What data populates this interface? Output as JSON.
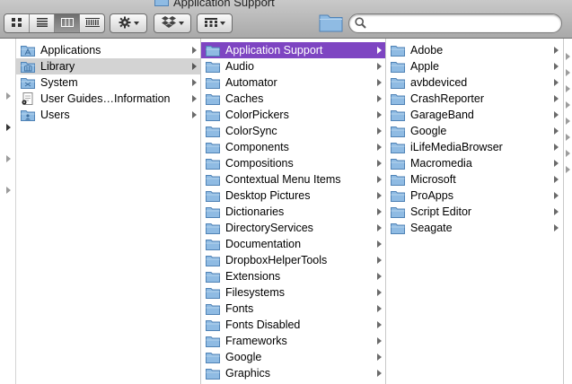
{
  "window": {
    "title": "Application Support"
  },
  "toolbar": {
    "views": [
      {
        "name": "icon-view",
        "active": false
      },
      {
        "name": "list-view",
        "active": false
      },
      {
        "name": "column-view",
        "active": true
      },
      {
        "name": "coverflow-view",
        "active": false
      }
    ],
    "search": {
      "value": "",
      "placeholder": ""
    }
  },
  "columns": [
    {
      "items": [
        {
          "label": "Applications",
          "icon": "applications-folder-icon",
          "arrow": true,
          "state": ""
        },
        {
          "label": "Library",
          "icon": "library-folder-icon",
          "arrow": true,
          "state": "path"
        },
        {
          "label": "System",
          "icon": "system-folder-icon",
          "arrow": true,
          "state": ""
        },
        {
          "label": "User Guides…Information",
          "icon": "document-folder-icon",
          "arrow": true,
          "state": ""
        },
        {
          "label": "Users",
          "icon": "users-folder-icon",
          "arrow": true,
          "state": ""
        }
      ]
    },
    {
      "items": [
        {
          "label": "Application Support",
          "icon": "folder-icon",
          "arrow": true,
          "state": "selected"
        },
        {
          "label": "Audio",
          "icon": "folder-icon",
          "arrow": true,
          "state": ""
        },
        {
          "label": "Automator",
          "icon": "folder-icon",
          "arrow": true,
          "state": ""
        },
        {
          "label": "Caches",
          "icon": "folder-icon",
          "arrow": true,
          "state": ""
        },
        {
          "label": "ColorPickers",
          "icon": "folder-icon",
          "arrow": true,
          "state": ""
        },
        {
          "label": "ColorSync",
          "icon": "folder-icon",
          "arrow": true,
          "state": ""
        },
        {
          "label": "Components",
          "icon": "folder-icon",
          "arrow": true,
          "state": ""
        },
        {
          "label": "Compositions",
          "icon": "folder-icon",
          "arrow": true,
          "state": ""
        },
        {
          "label": "Contextual Menu Items",
          "icon": "folder-icon",
          "arrow": true,
          "state": ""
        },
        {
          "label": "Desktop Pictures",
          "icon": "folder-icon",
          "arrow": true,
          "state": ""
        },
        {
          "label": "Dictionaries",
          "icon": "folder-icon",
          "arrow": true,
          "state": ""
        },
        {
          "label": "DirectoryServices",
          "icon": "folder-icon",
          "arrow": true,
          "state": ""
        },
        {
          "label": "Documentation",
          "icon": "folder-icon",
          "arrow": true,
          "state": ""
        },
        {
          "label": "DropboxHelperTools",
          "icon": "folder-icon",
          "arrow": true,
          "state": ""
        },
        {
          "label": "Extensions",
          "icon": "folder-icon",
          "arrow": true,
          "state": ""
        },
        {
          "label": "Filesystems",
          "icon": "folder-icon",
          "arrow": true,
          "state": ""
        },
        {
          "label": "Fonts",
          "icon": "folder-icon",
          "arrow": true,
          "state": ""
        },
        {
          "label": "Fonts Disabled",
          "icon": "folder-icon",
          "arrow": true,
          "state": ""
        },
        {
          "label": "Frameworks",
          "icon": "folder-icon",
          "arrow": true,
          "state": ""
        },
        {
          "label": "Google",
          "icon": "folder-icon",
          "arrow": true,
          "state": ""
        },
        {
          "label": "Graphics",
          "icon": "folder-icon",
          "arrow": true,
          "state": ""
        }
      ]
    },
    {
      "items": [
        {
          "label": "Adobe",
          "icon": "folder-icon",
          "arrow": true,
          "state": ""
        },
        {
          "label": "Apple",
          "icon": "folder-icon",
          "arrow": true,
          "state": ""
        },
        {
          "label": "avbdeviced",
          "icon": "folder-icon",
          "arrow": true,
          "state": ""
        },
        {
          "label": "CrashReporter",
          "icon": "folder-icon",
          "arrow": true,
          "state": ""
        },
        {
          "label": "GarageBand",
          "icon": "folder-icon",
          "arrow": true,
          "state": ""
        },
        {
          "label": "Google",
          "icon": "folder-icon",
          "arrow": true,
          "state": ""
        },
        {
          "label": "iLifeMediaBrowser",
          "icon": "folder-icon",
          "arrow": true,
          "state": ""
        },
        {
          "label": "Macromedia",
          "icon": "folder-icon",
          "arrow": true,
          "state": ""
        },
        {
          "label": "Microsoft",
          "icon": "folder-icon",
          "arrow": true,
          "state": ""
        },
        {
          "label": "ProApps",
          "icon": "folder-icon",
          "arrow": true,
          "state": ""
        },
        {
          "label": "Script Editor",
          "icon": "folder-icon",
          "arrow": true,
          "state": ""
        },
        {
          "label": "Seagate",
          "icon": "folder-icon",
          "arrow": true,
          "state": ""
        }
      ]
    }
  ],
  "colors": {
    "selection": "#7e45c2",
    "path_highlight": "#d3d3d3",
    "folder_blue": "#7fb1de"
  }
}
